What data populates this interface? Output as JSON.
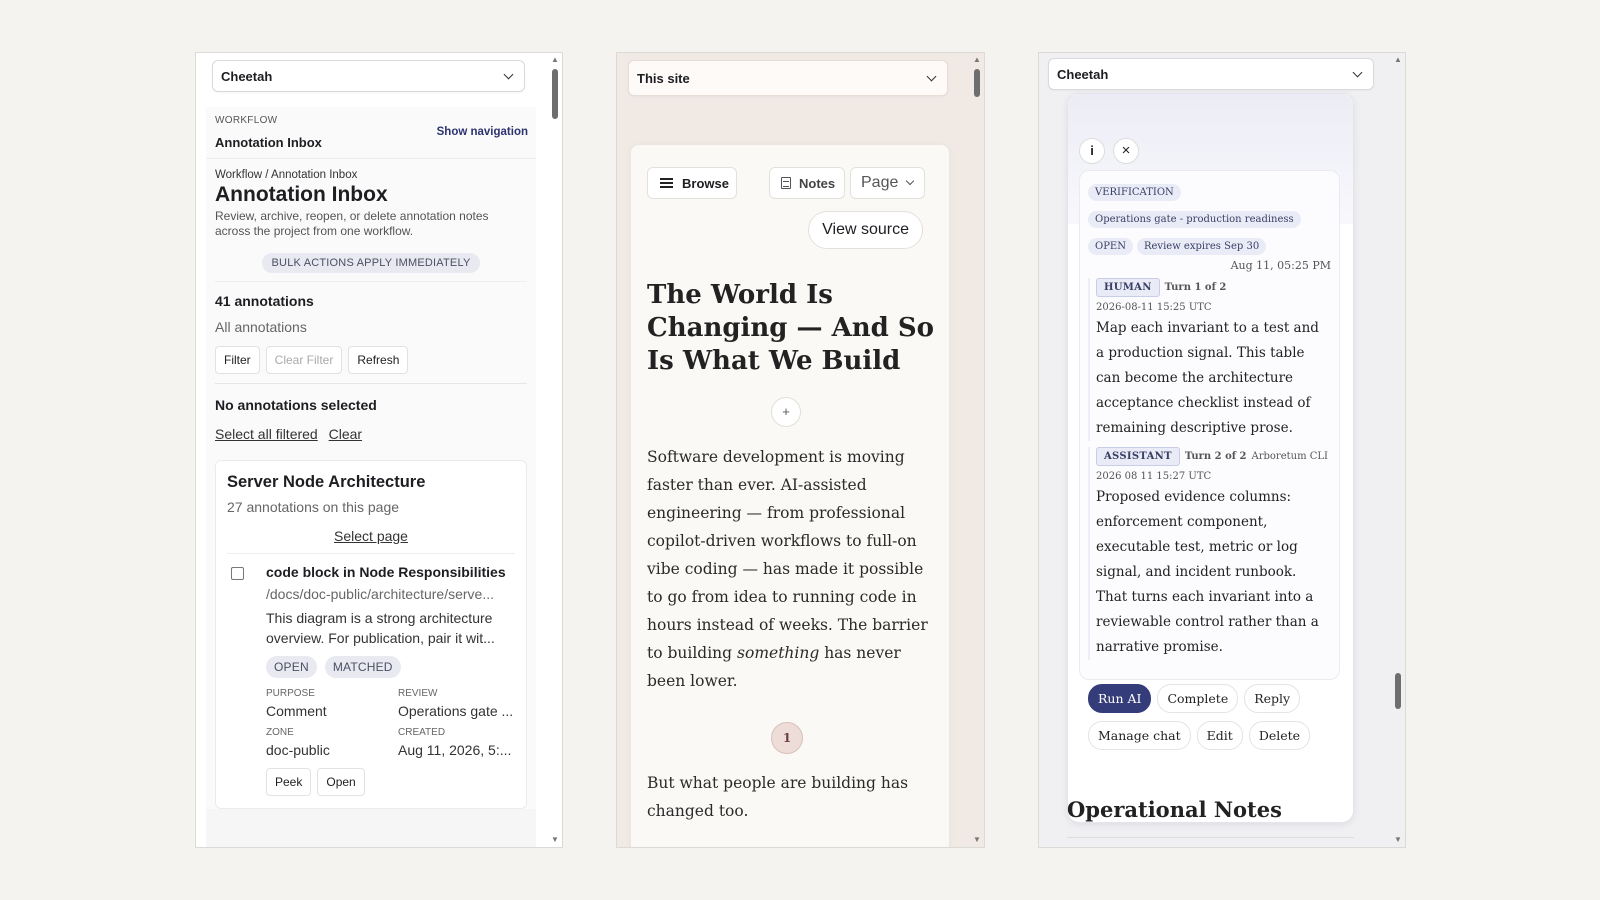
{
  "panel1": {
    "selector": "Cheetah",
    "eyebrow": "WORKFLOW",
    "head_title": "Annotation Inbox",
    "show_nav": "Show navigation",
    "breadcrumb": "Workflow / Annotation Inbox",
    "title": "Annotation Inbox",
    "description": "Review, archive, reopen, or delete annotation notes across the project from one workflow.",
    "bulk_notice": "BULK ACTIONS APPLY IMMEDIATELY",
    "count": "41 annotations",
    "filter_label": "All annotations",
    "buttons": {
      "filter": "Filter",
      "clear_filter": "Clear Filter",
      "refresh": "Refresh"
    },
    "selection": "No annotations selected",
    "select_all": "Select all filtered",
    "clear": "Clear",
    "card": {
      "title": "Server Node Architecture",
      "sub": "27 annotations on this page",
      "select_page": "Select page",
      "item": {
        "title": "code block in Node Responsibilities",
        "path": "/docs/doc-public/architecture/serve...",
        "text": "This diagram is a strong architecture overview. For publication, pair it wit...",
        "tags": [
          "OPEN",
          "MATCHED"
        ],
        "purpose_label": "PURPOSE",
        "purpose": "Comment",
        "review_label": "REVIEW",
        "review": "Operations gate ...",
        "zone_label": "ZONE",
        "zone": "doc-public",
        "created_label": "CREATED",
        "created": "Aug 11, 2026, 5:...",
        "peek": "Peek",
        "open": "Open"
      }
    }
  },
  "panel2": {
    "selector": "This site",
    "browse": "Browse",
    "notes": "Notes",
    "page": "Page",
    "view_source": "View source",
    "title": "The World Is Changing — And So Is What We Build",
    "plus": "+",
    "para1_a": "Software development is moving faster than ever. AI-assisted engineering — from professional copilot-driven workflows to full-on vibe coding — has made it possible to go from idea to running code in hours instead of weeks. The barrier to building ",
    "para1_em": "something",
    "para1_b": " has never been lower.",
    "footnote": "1",
    "para2": "But what people are building has changed too."
  },
  "panel3": {
    "selector": "Cheetah",
    "info": "i",
    "close": "×",
    "badges": {
      "verification": "VERIFICATION",
      "gate": "Operations gate - production readiness",
      "open": "OPEN",
      "expires": "Review expires Sep 30"
    },
    "date": "Aug 11, 05:25 PM",
    "turn1": {
      "role": "HUMAN",
      "turn": "Turn 1 of 2",
      "time": "2026-08-11 15:25 UTC",
      "text": "Map each invariant to a test and a production signal. This table can become the architecture acceptance checklist instead of remaining descriptive prose."
    },
    "turn2": {
      "role": "ASSISTANT",
      "turn": "Turn 2 of 2",
      "source": "Arboretum CLI",
      "time": "2026 08 11 15:27 UTC",
      "text": "Proposed evidence columns: enforcement component, executable test, metric or log signal, and incident runbook. That turns each invariant into a reviewable control rather than a narrative promise."
    },
    "actions": {
      "run_ai": "Run AI",
      "complete": "Complete",
      "reply": "Reply",
      "manage_chat": "Manage chat",
      "edit": "Edit",
      "delete": "Delete"
    },
    "section_heading": "Operational Notes"
  }
}
